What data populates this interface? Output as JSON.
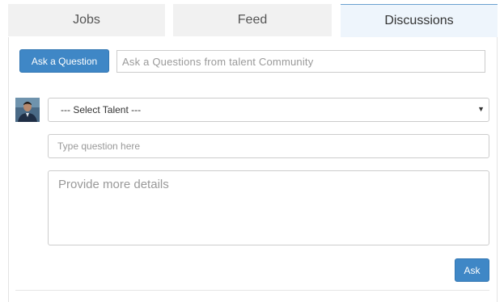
{
  "tabs": [
    {
      "label": "Jobs"
    },
    {
      "label": "Feed"
    },
    {
      "label": "Discussions"
    }
  ],
  "active_tab": "Discussions",
  "ask_bar": {
    "button_label": "Ask a Question",
    "input_placeholder": "Ask a Questions from talent Community",
    "input_value": ""
  },
  "form": {
    "talent_select": {
      "selected_label": "--- Select Talent ---"
    },
    "question_input": {
      "placeholder": "Type question here",
      "value": ""
    },
    "details_textarea": {
      "placeholder": "Provide more details",
      "value": ""
    },
    "submit_label": "Ask"
  },
  "icons": {
    "dropdown": "caret-down-icon",
    "avatar": "user-avatar"
  },
  "colors": {
    "accent": "#3f87c6",
    "active_tab_bg": "#eef5fc",
    "inactive_tab_bg": "#f1f1f1",
    "active_tab_border": "#6aa0d0"
  }
}
